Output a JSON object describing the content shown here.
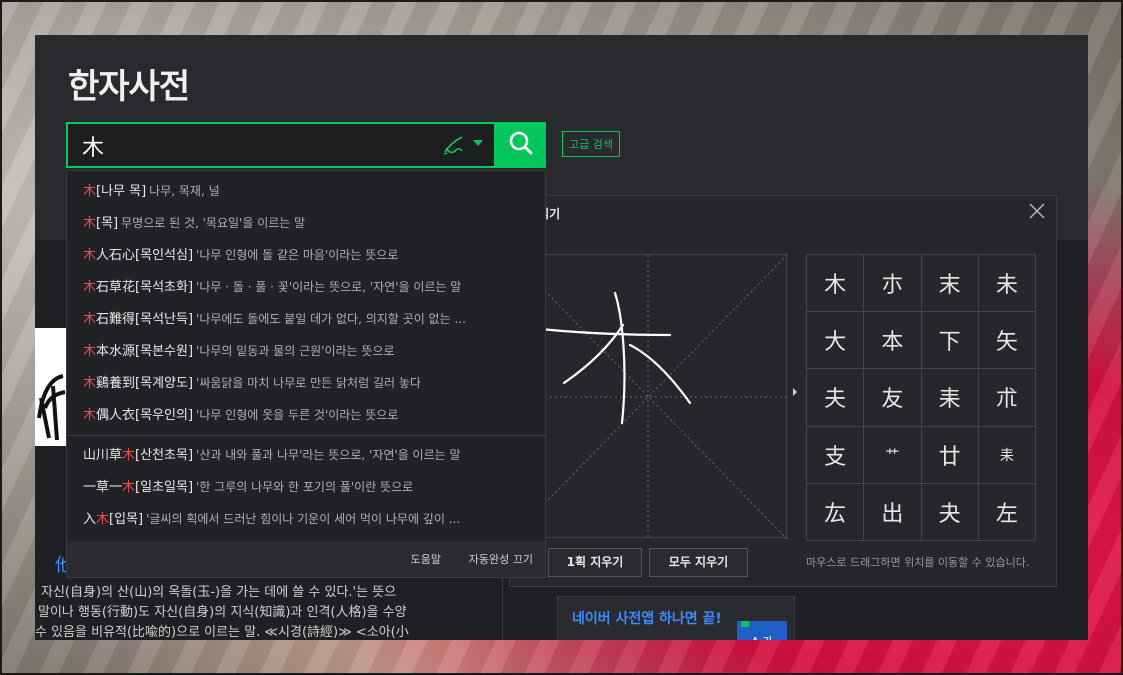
{
  "page": {
    "title": "한자사전"
  },
  "search": {
    "value": "木",
    "advanced_label": "고급 검색"
  },
  "autocomplete": {
    "items": [
      {
        "pre": "",
        "hl": "木",
        "post": "",
        "reading": "[나무 목]",
        "desc": "나무, 목재, 널"
      },
      {
        "pre": "",
        "hl": "木",
        "post": "",
        "reading": "[목]",
        "desc": "무명으로 된 것, '목요일'을 이르는 말"
      },
      {
        "pre": "",
        "hl": "木",
        "post": "人石心",
        "reading": "[목인석심]",
        "desc": "'나무 인형에 돌 같은 마음'이라는 뜻으로"
      },
      {
        "pre": "",
        "hl": "木",
        "post": "石草花",
        "reading": "[목석초화]",
        "desc": "'나무 · 돌 · 풀 · 꽃'이라는 뜻으로, '자연'을 이르는 말"
      },
      {
        "pre": "",
        "hl": "木",
        "post": "石難得",
        "reading": "[목석난득]",
        "desc": "'나무에도 돌에도 붙일 데가 없다, 의지할 곳이 없는 ..."
      },
      {
        "pre": "",
        "hl": "木",
        "post": "本水源",
        "reading": "[목본수원]",
        "desc": "'나무의 밑동과 물의 근원'이라는 뜻으로"
      },
      {
        "pre": "",
        "hl": "木",
        "post": "鷄養到",
        "reading": "[목계양도]",
        "desc": "'싸움닭을 마치 나무로 만든 닭처럼 길러 놓다"
      },
      {
        "pre": "",
        "hl": "木",
        "post": "偶人衣",
        "reading": "[목우인의]",
        "desc": "'나무 인형에 옷을 두른 것'이라는 뜻으로"
      },
      {
        "pre": "山川草",
        "hl": "木",
        "post": "",
        "reading": "[산천초목]",
        "desc": "'산과 내와 풀과 나무'라는 뜻으로, '자연'을 이르는 말"
      },
      {
        "pre": "一草一",
        "hl": "木",
        "post": "",
        "reading": "[일초일목]",
        "desc": "'한 그루의 나무와 한 포기의 풀'이란 뜻으로"
      },
      {
        "pre": "入",
        "hl": "木",
        "post": "",
        "reading": "[입목]",
        "desc": "'글씨의 획에서 드러난 힘이나 기운이 세어 먹이 나무에 깊이 ..."
      }
    ],
    "help_label": "도움말",
    "autocomplete_off_label": "자동완성 끄기"
  },
  "handwriting": {
    "title": "기인식기",
    "candidates": [
      "木",
      "朩",
      "末",
      "未",
      "大",
      "本",
      "下",
      "矢",
      "夫",
      "友",
      "耒",
      "朮",
      "支",
      "艹",
      "廿",
      "耒",
      "厷",
      "出",
      "夬",
      "左"
    ],
    "clear_stroke_label": "1획 지우기",
    "clear_all_label": "모두 지우기",
    "hint": "마우스로 드래그하면 위치를 이동할 수 있습니다."
  },
  "entry": {
    "char": "他",
    "lines": [
      "자신(自身)의 산(山)의 옥돌(玉-)을 가는 데에 쓸 수 있다.'는 뜻으",
      "말이나 행동(行動)도 자신(自身)의 지식(知識)과 인격(人格)을 수양",
      "수 있음을 비유적(比喩的)으로 이르는 말. ≪시경(詩經)≫ <소아(小"
    ]
  },
  "promo": {
    "text": "네이버 사전앱 하나면 끝!",
    "icon_text": "A 가"
  },
  "colors": {
    "accent": "#03c75a",
    "highlight": "#e84c4c",
    "link": "#3d8bff"
  }
}
